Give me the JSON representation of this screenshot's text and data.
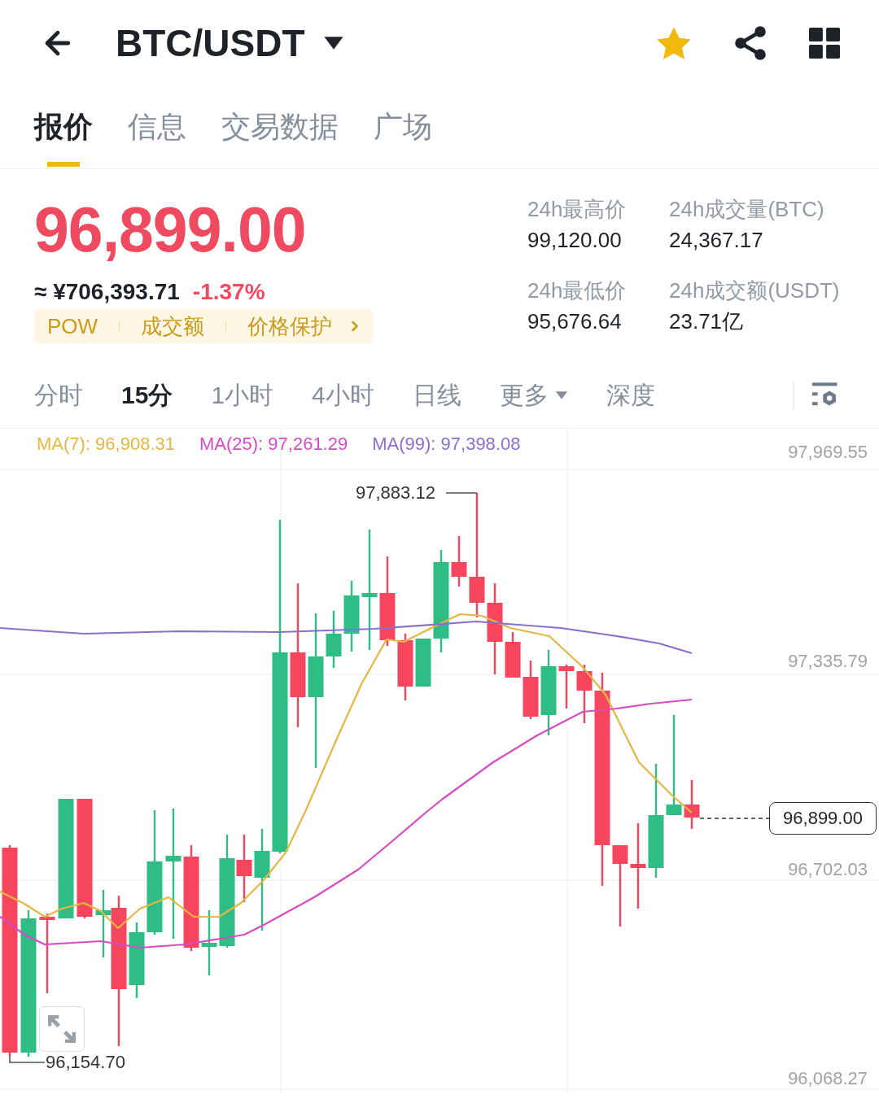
{
  "header": {
    "title": "BTC/USDT",
    "favorite": true
  },
  "tabs": [
    {
      "label": "报价",
      "selected": true
    },
    {
      "label": "信息",
      "selected": false
    },
    {
      "label": "交易数据",
      "selected": false
    },
    {
      "label": "广场",
      "selected": false
    }
  ],
  "quote": {
    "price": "96,899.00",
    "fiat": "≈ ¥706,393.71",
    "change": "-1.37%",
    "tags": [
      "POW",
      "成交额",
      "价格保护"
    ]
  },
  "stats": [
    {
      "label": "24h最高价",
      "value": "99,120.00"
    },
    {
      "label": "24h成交量(BTC)",
      "value": "24,367.17"
    },
    {
      "label": "24h最低价",
      "value": "95,676.64"
    },
    {
      "label": "24h成交额(USDT)",
      "value": "23.71亿"
    }
  ],
  "intervals": [
    {
      "label": "分时",
      "kind": "option",
      "selected": false
    },
    {
      "label": "15分",
      "kind": "option",
      "selected": true
    },
    {
      "label": "1小时",
      "kind": "option",
      "selected": false
    },
    {
      "label": "4小时",
      "kind": "option",
      "selected": false
    },
    {
      "label": "日线",
      "kind": "option",
      "selected": false
    },
    {
      "label": "更多",
      "kind": "menu",
      "selected": false
    },
    {
      "label": "深度",
      "kind": "option",
      "selected": false
    }
  ],
  "chart": {
    "moving_averages": [
      {
        "label": "MA(7): 96,908.31",
        "color": "#e6b740"
      },
      {
        "label": "MA(25): 97,261.29",
        "color": "#d84bc2"
      },
      {
        "label": "MA(99): 97,398.08",
        "color": "#8a6fcb"
      }
    ],
    "price_axis": [
      "97,969.55",
      "97,335.79",
      "96,702.03",
      "96,068.27"
    ],
    "high_label": "97,883.12",
    "low_label": "96,154.70",
    "last_price": "96,899.00"
  }
}
